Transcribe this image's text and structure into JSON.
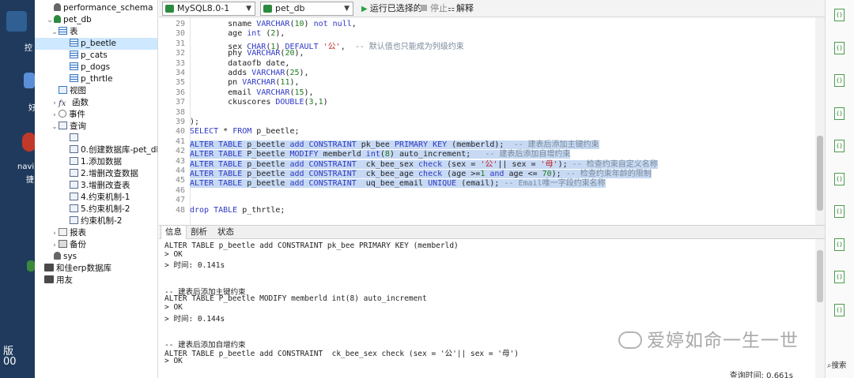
{
  "desktop": {
    "labels": [
      "控",
      "好",
      "navi",
      "捷",
      "版",
      "00"
    ]
  },
  "tree": {
    "items": [
      {
        "label": "performance_schema",
        "type": "dbg",
        "level": 1,
        "twisty": ""
      },
      {
        "label": "pet_db",
        "type": "db",
        "level": 1,
        "twisty": "⌄"
      },
      {
        "label": "表",
        "type": "tbl",
        "level": 2,
        "twisty": "⌄"
      },
      {
        "label": "p_beetle",
        "type": "tbl",
        "level": 3,
        "twisty": "",
        "selected": true
      },
      {
        "label": "p_cats",
        "type": "tbl",
        "level": 3,
        "twisty": ""
      },
      {
        "label": "p_dogs",
        "type": "tbl",
        "level": 3,
        "twisty": ""
      },
      {
        "label": "p_thrtle",
        "type": "tbl",
        "level": 3,
        "twisty": ""
      },
      {
        "label": "视图",
        "type": "view",
        "level": 2,
        "twisty": ""
      },
      {
        "label": "函数",
        "type": "fx",
        "level": 2,
        "twisty": "›"
      },
      {
        "label": "事件",
        "type": "ev",
        "level": 2,
        "twisty": "›"
      },
      {
        "label": "查询",
        "type": "q",
        "level": 2,
        "twisty": "⌄"
      },
      {
        "label": "",
        "type": "q",
        "level": 3,
        "twisty": ""
      },
      {
        "label": "0.创建数据库-pet_db",
        "type": "q",
        "level": 3,
        "twisty": ""
      },
      {
        "label": "1.添加数据",
        "type": "q",
        "level": 3,
        "twisty": ""
      },
      {
        "label": "2.增删改查数据",
        "type": "q",
        "level": 3,
        "twisty": ""
      },
      {
        "label": "3.增删改查表",
        "type": "q",
        "level": 3,
        "twisty": ""
      },
      {
        "label": "4.约束机制-1",
        "type": "q",
        "level": 3,
        "twisty": ""
      },
      {
        "label": "5.约束机制-2",
        "type": "q",
        "level": 3,
        "twisty": ""
      },
      {
        "label": "约束机制-2",
        "type": "q",
        "level": 3,
        "twisty": ""
      },
      {
        "label": "报表",
        "type": "rep",
        "level": 2,
        "twisty": "›"
      },
      {
        "label": "备份",
        "type": "bak",
        "level": 2,
        "twisty": "›"
      },
      {
        "label": "sys",
        "type": "dbg",
        "level": 1,
        "twisty": ""
      },
      {
        "label": "和佳erp数据库",
        "type": "conn",
        "level": 0,
        "twisty": ""
      },
      {
        "label": "用友",
        "type": "conn",
        "level": 0,
        "twisty": ""
      }
    ]
  },
  "toolbar": {
    "connection": "MySQL8.0-1",
    "database": "pet_db",
    "run_selected": "运行已选择的",
    "stop": "停止",
    "explain": "解释"
  },
  "editor": {
    "lines": [
      {
        "n": "29",
        "html": "        sname <span class=\"kw\">VARCHAR</span>(<span class=\"num\">10</span>) <span class=\"kw\">not null</span>,"
      },
      {
        "n": "30",
        "html": "        age <span class=\"kw\">int</span> (<span class=\"num\">2</span>),"
      },
      {
        "n": "31",
        "html": "        sex <span class=\"kw\">CHAR</span>(<span class=\"num\">1</span>) <span class=\"kw\">DEFAULT</span> <span class=\"str\">'公'</span>,  <span class=\"cm\">-- 默认值也只能成为列级约束</span>"
      },
      {
        "n": "32",
        "html": "        phy <span class=\"kw\">VARCHAR</span>(<span class=\"num\">20</span>),"
      },
      {
        "n": "33",
        "html": "        dataofb date,"
      },
      {
        "n": "34",
        "html": "        adds <span class=\"kw\">VARCHAR</span>(<span class=\"num\">25</span>),"
      },
      {
        "n": "35",
        "html": "        pn <span class=\"kw\">VARCHAR</span>(<span class=\"num\">11</span>),"
      },
      {
        "n": "36",
        "html": "        email <span class=\"kw\">VARCHAR</span>(<span class=\"num\">15</span>),"
      },
      {
        "n": "37",
        "html": "        ckuscores <span class=\"kw\">DOUBLE</span>(<span class=\"num\">3</span>,<span class=\"num\">1</span>)"
      },
      {
        "n": "38",
        "html": ""
      },
      {
        "n": "39",
        "html": ");"
      },
      {
        "n": "40",
        "html": "<span class=\"kw\">SELECT</span> * <span class=\"kw\">FROM</span> p_beetle;"
      },
      {
        "n": "41",
        "hl": true,
        "html": "<span class=\"bg\"><span class=\"kw\">ALTER TABLE</span> p_beetle <span class=\"kw\">add CONSTRAINT</span> pk_bee <span class=\"kw\">PRIMARY KEY</span> (memberld);  <span class=\"cm\">-- 建表后添加主键约束</span></span>"
      },
      {
        "n": "42",
        "hl": true,
        "html": "<span class=\"bg\"><span class=\"kw\">ALTER TABLE</span> P_beetle <span class=\"kw\">MODIFY</span> memberld <span class=\"kw\">int</span>(<span class=\"num\">8</span>) auto_increment;   <span class=\"cm\">-- 建表后添加自增约束</span></span>"
      },
      {
        "n": "43",
        "hl": true,
        "html": "<span class=\"bg\"><span class=\"kw\">ALTER TABLE</span> p_beetle <span class=\"kw\">add CONSTRAINT</span>  ck_bee_sex <span class=\"kw\">check</span> (sex = <span class=\"str\">'公'</span>|| sex = <span class=\"str\">'母'</span>); <span class=\"cm\">-- 检查约束自定义名称</span></span>"
      },
      {
        "n": "44",
        "hl": true,
        "html": "<span class=\"bg\"><span class=\"kw\">ALTER TABLE</span> p_beetle <span class=\"kw\">add CONSTRAINT</span>  ck_bee_age <span class=\"kw\">check</span> (age &gt;=<span class=\"num\">1</span> <span class=\"kw\">and</span> age &lt;= <span class=\"num\">70</span>); <span class=\"cm\">-- 检查约束年龄的限制</span></span>"
      },
      {
        "n": "45",
        "hl": true,
        "html": "<span class=\"bg\"><span class=\"kw\">ALTER TABLE</span> p_beetle <span class=\"kw\">add CONSTRAINT</span>  uq_bee_email <span class=\"kw\">UNIQUE</span> (email); <span class=\"cm\">-- Email唯一字段约束名称</span></span>"
      },
      {
        "n": "46",
        "html": ""
      },
      {
        "n": "47",
        "html": ""
      },
      {
        "n": "48",
        "html": "<span class=\"kw\">drop TABLE</span> p_thrtle;"
      }
    ]
  },
  "tabs": [
    "信息",
    "剖析",
    "状态"
  ],
  "output": {
    "lines": [
      "ALTER TABLE p_beetle add CONSTRAINT pk_bee PRIMARY KEY (memberld)",
      "> OK",
      "> 时间: 0.141s",
      "",
      "",
      "-- 建表后添加主键约束",
      "ALTER TABLE P_beetle MODIFY memberld int(8) auto_increment",
      "> OK",
      "> 时间: 0.144s",
      "",
      "",
      "-- 建表后添加自增约束",
      "ALTER TABLE p_beetle add CONSTRAINT  ck_bee_sex check (sex = '公'|| sex = '母')",
      "> OK"
    ],
    "status": "查询时间: 0.661s"
  },
  "watermark": "爱婷如命一生一世",
  "right_panel": {
    "icon_count": 10,
    "search": "搜索"
  }
}
